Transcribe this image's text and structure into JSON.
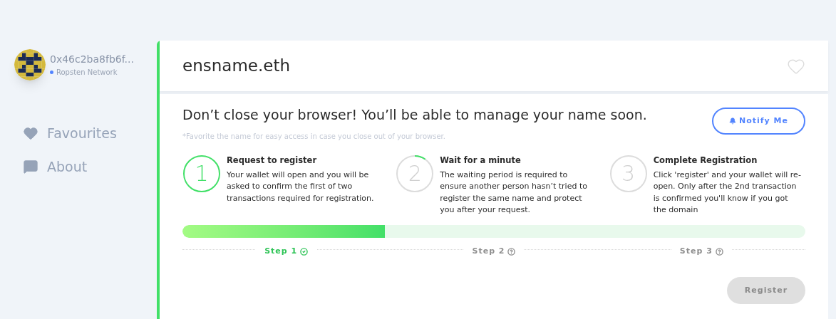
{
  "account": {
    "address": "0x46c2ba8fb6f...",
    "network": "Ropsten Network"
  },
  "sidebar": {
    "items": [
      {
        "label": "Favourites",
        "kind": "heart",
        "selected": false
      },
      {
        "label": "About",
        "kind": "chat",
        "selected": false
      }
    ]
  },
  "name": {
    "title": "ensname.eth",
    "favourite": false
  },
  "notice": {
    "title": "Don’t close your browser! You’ll be able to manage your name soon.",
    "hint": "*Favorite the name for easy access in case you close out of your browser."
  },
  "notify_button": "Notify Me",
  "steps": [
    {
      "number": "1",
      "title": "Request to register",
      "text": "Your wallet will open and you will be asked to confirm the first of two transactions required for registration.",
      "kind": "done"
    },
    {
      "number": "2",
      "title": "Wait for a minute",
      "text": "The waiting period is required to ensure another person hasn’t tried to register the same name and protect you after your request.",
      "kind": "active"
    },
    {
      "number": "3",
      "title": "Complete Registration",
      "text": "Click 'register' and your wallet will re-open. Only after the 2nd transaction is confirmed you'll know if you got the domain",
      "kind": "pending"
    }
  ],
  "progress": {
    "level": 0.325
  },
  "step_labels": [
    {
      "label": "Step 1",
      "done": true
    },
    {
      "label": "Step 2",
      "done": false
    },
    {
      "label": "Step 3",
      "done": false
    }
  ],
  "register_button": {
    "label": "Register",
    "disabled": true
  }
}
